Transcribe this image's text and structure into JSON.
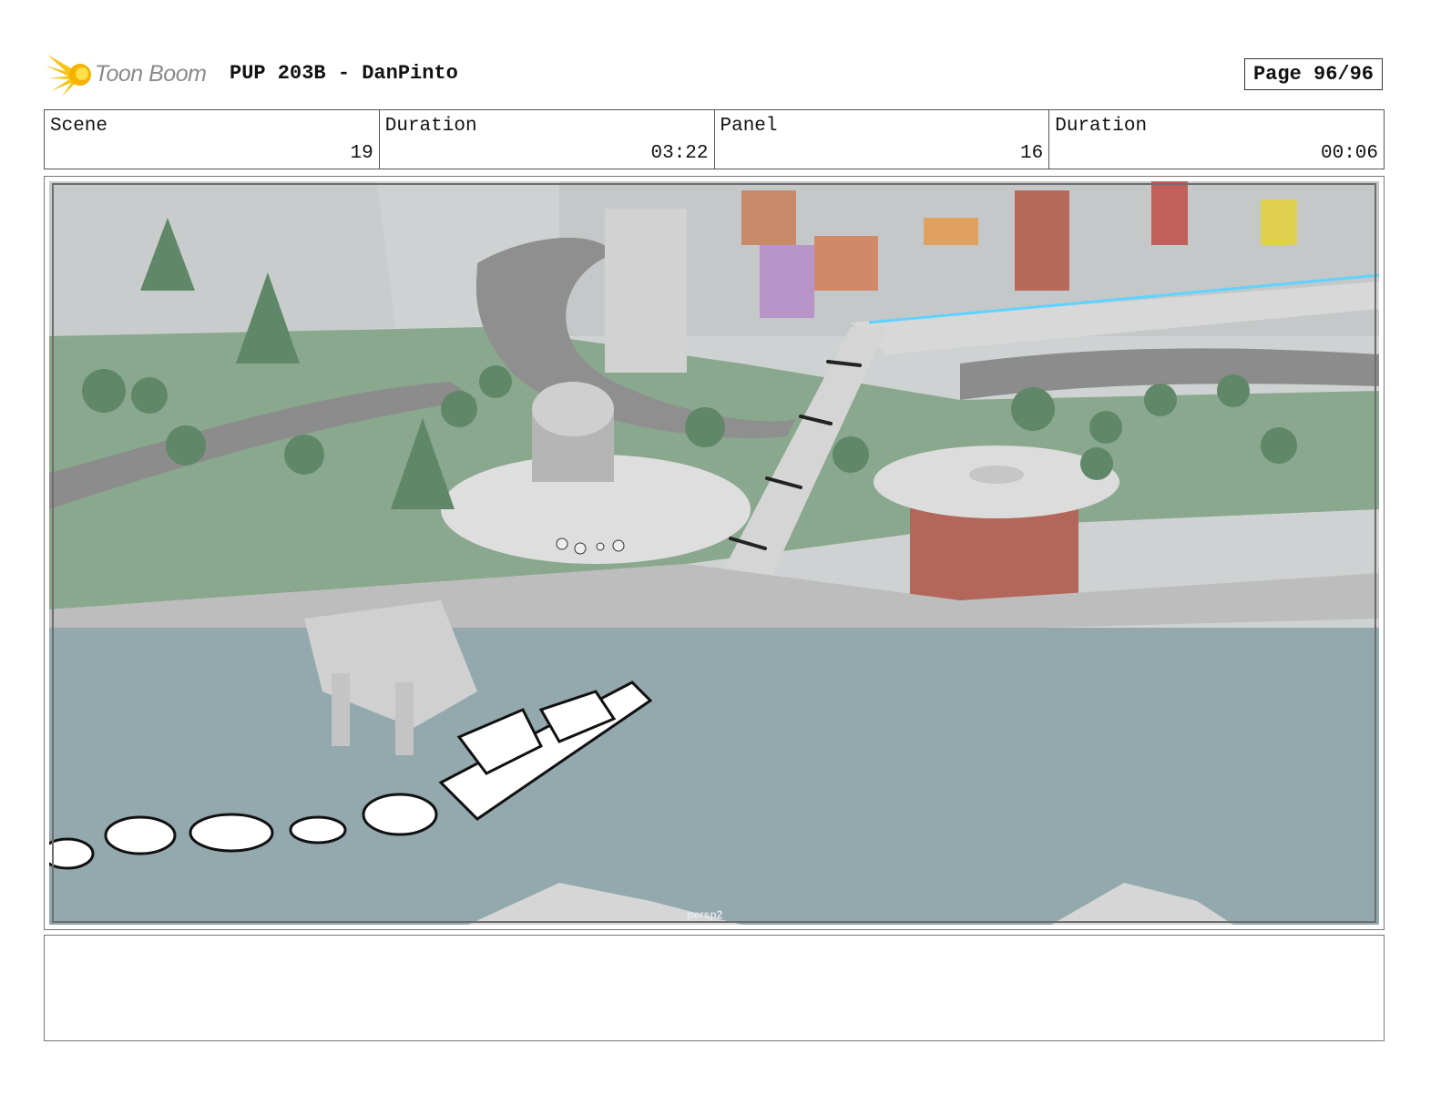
{
  "header": {
    "logo_text": "Toon Boom",
    "title": "PUP 203B - DanPinto",
    "page": "Page 96/96"
  },
  "info": {
    "scene_label": "Scene",
    "scene_value": "19",
    "scene_duration_label": "Duration",
    "scene_duration_value": "03:22",
    "panel_label": "Panel",
    "panel_value": "16",
    "panel_duration_label": "Duration",
    "panel_duration_value": "00:06"
  },
  "panel": {
    "camera_label": "persp2",
    "icons": [
      "sun-burst-logo-icon"
    ]
  },
  "colors": {
    "logo_yellow": "#f5c518",
    "water": "#93a9ad",
    "grass": "#8aa88e",
    "road": "#8c8c8c"
  },
  "notes": {
    "text": ""
  }
}
